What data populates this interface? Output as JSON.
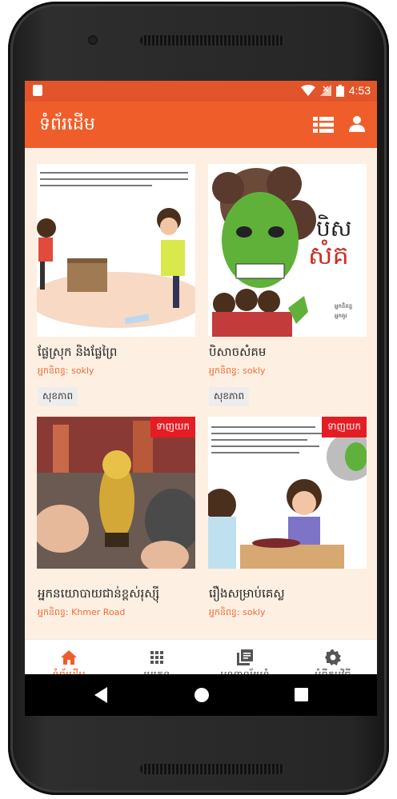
{
  "status": {
    "time": "4:53"
  },
  "appbar": {
    "title": "ទំព័រដើម"
  },
  "cards": [
    {
      "title": "ផ្លែស្រុក និងផ្លែព្រៃ",
      "author": "អ្នកនិពន្ធ: sokly",
      "tag": "សុខភាព",
      "badge": "",
      "thumb_text": "ផ្លែឈើជាប្រភពវីតាមីនដ៏សំខាន់សម្រាប់សុខភាព..."
    },
    {
      "title": "បិសាចសំគម",
      "author": "អ្នកនិពន្ធ: sokly",
      "tag": "សុខភាព",
      "badge": "",
      "thumb_text": "បិសាច សំគម",
      "thumb_credit1": "អ្នកនិពន្ធ: ម៉ៅ",
      "thumb_credit2": "អ្នកគូរ: ឃ្មុំ"
    },
    {
      "title": "អ្នកនយោបាយជាន់ខ្ពស់រុស្ស៊ី",
      "author": "អ្នកនិពន្ធ: Khmer Road",
      "tag": "",
      "badge": "ទាញយក"
    },
    {
      "title": "រឿងសម្រាប់គេស្ល",
      "author": "អ្នកនិពន្ធ: sokly",
      "tag": "",
      "badge": "ទាញយក",
      "thumb_text": "មិត្តភក្តិម្នាក់បានសួរ... ហេតុអ្វីត្រូវញ៉ាំបន្លែ..."
    }
  ],
  "bottom_nav": [
    {
      "label": "ទំព័រដើម",
      "icon": "home-icon",
      "active": true
    },
    {
      "label": "ប្រភេទ",
      "icon": "grid-icon",
      "active": false
    },
    {
      "label": "បណ្ណាល័យខ្ញុំ",
      "icon": "library-icon",
      "active": false
    },
    {
      "label": "អំពីកម្មវិធី",
      "icon": "gear-icon",
      "active": false
    }
  ],
  "colors": {
    "primary": "#ef5e2a",
    "status": "#e2552a",
    "background": "#fdf0e3",
    "badge": "#e51c23"
  }
}
